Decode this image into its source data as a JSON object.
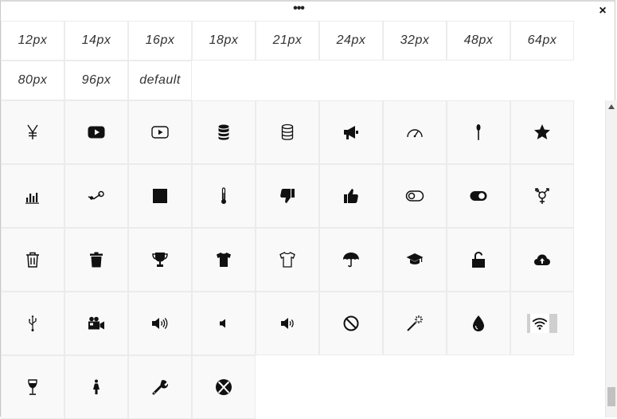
{
  "window": {
    "menu_glyph": "•••",
    "close_glyph": "×"
  },
  "sizes": [
    "12px",
    "14px",
    "16px",
    "18px",
    "21px",
    "24px",
    "32px",
    "48px",
    "64px",
    "80px",
    "96px",
    "default"
  ],
  "icons": [
    "yen-icon",
    "youtube-play-icon",
    "youtube-play-outline-icon",
    "database-icon",
    "database-outline-icon",
    "megaphone-icon",
    "tachometer-icon",
    "spoon-icon",
    "star-icon",
    "bar-chart-icon",
    "steam-icon",
    "stop-square-icon",
    "thermometer-icon",
    "thumbs-down-icon",
    "thumbs-up-icon",
    "toggle-off-icon",
    "toggle-on-icon",
    "transgender-icon",
    "trash-icon",
    "trash-alt-icon",
    "trophy-icon",
    "tshirt-icon",
    "tshirt-outline-icon",
    "umbrella-icon",
    "graduation-cap-icon",
    "unlock-icon",
    "cloud-upload-icon",
    "usb-icon",
    "video-camera-icon",
    "volume-up-icon",
    "volume-off-icon",
    "volume-down-icon",
    "ban-icon",
    "magic-wand-icon",
    "water-drop-icon",
    "wifi-icon",
    "wine-glass-icon",
    "female-icon",
    "wrench-icon",
    "xbox-icon"
  ]
}
